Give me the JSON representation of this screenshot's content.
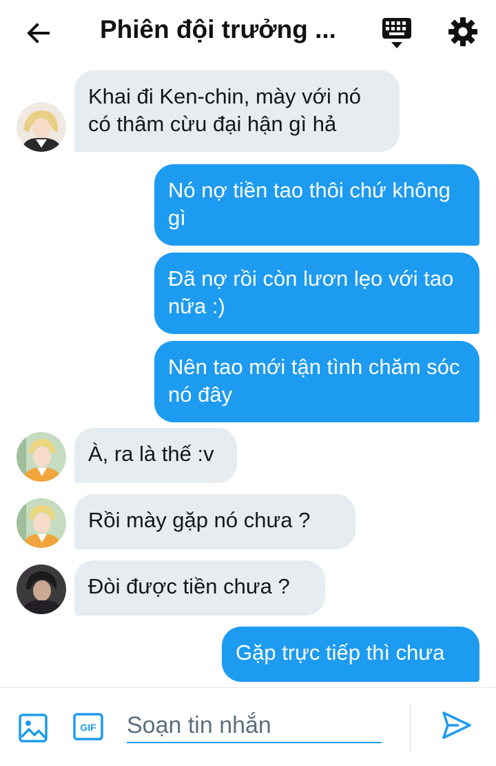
{
  "header": {
    "title": "Phiên đội trưởng ...",
    "back_icon": "arrow-left-icon",
    "keyboard_icon": "keyboard-icon",
    "settings_icon": "gear-icon"
  },
  "messages": [
    {
      "side": "in",
      "text": "Khai đi Ken-chin, mày với nó có thâm cừu đại hận gì hả",
      "avatar": "avatar-blonde-girl"
    },
    {
      "side": "out",
      "text": "Nó nợ tiền tao thôi chứ không gì"
    },
    {
      "side": "out",
      "text": "Đã nợ rồi còn lươn lẹo với tao nữa :)"
    },
    {
      "side": "out",
      "text": "Nên tao mới tận tình chăm sóc nó đây"
    },
    {
      "side": "in",
      "text": "À, ra là thế :v",
      "avatar": "avatar-blond-boy"
    },
    {
      "side": "in",
      "text": "Rồi mày gặp nó chưa ?",
      "avatar": "avatar-blond-boy"
    },
    {
      "side": "in",
      "text": "Đòi được tiền chưa ?",
      "avatar": "avatar-dark-hair"
    },
    {
      "side": "out",
      "text": "Gặp trực tiếp thì chưa"
    }
  ],
  "composer": {
    "placeholder": "Soạn tin nhắn",
    "value": "",
    "gif_label": "GIF",
    "image_icon": "image-icon",
    "send_icon": "send-icon"
  },
  "colors": {
    "accent": "#1d9bf0",
    "incoming_bubble": "#e6ecf0"
  }
}
